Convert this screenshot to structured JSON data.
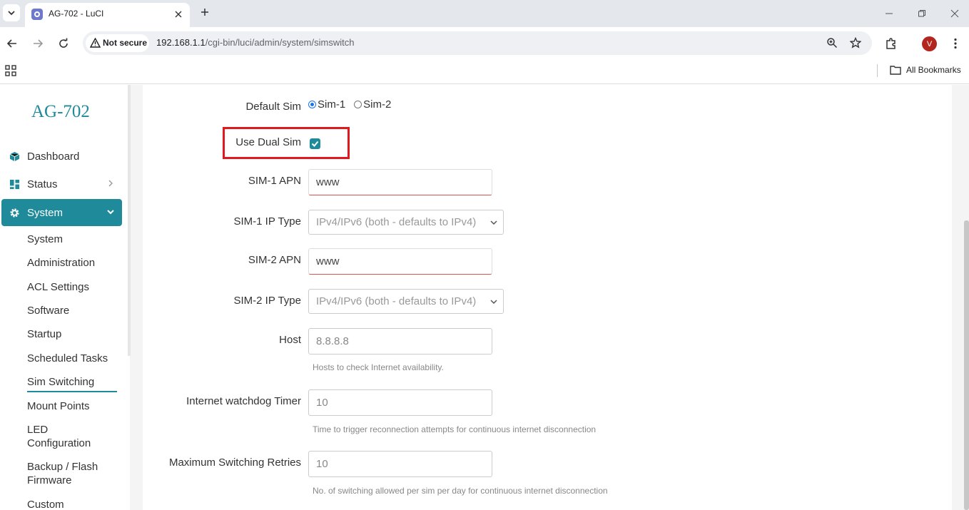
{
  "browser": {
    "tab_title": "AG-702 - LuCI",
    "security_label": "Not secure",
    "url_host": "192.168.1.1",
    "url_path": "/cgi-bin/luci/admin/system/simswitch",
    "avatar_letter": "V",
    "all_bookmarks": "All Bookmarks"
  },
  "sidebar": {
    "brand": "AG-702",
    "nav": [
      {
        "label": "Dashboard",
        "icon": "cube-icon"
      },
      {
        "label": "Status",
        "icon": "grid-icon"
      },
      {
        "label": "System",
        "icon": "gear-icon"
      }
    ],
    "sub": [
      "System",
      "Administration",
      "ACL Settings",
      "Software",
      "Startup",
      "Scheduled Tasks",
      "Sim Switching",
      "Mount Points",
      "LED Configuration",
      "Backup / Flash Firmware",
      "Custom"
    ],
    "accent": "#1f8a99"
  },
  "form": {
    "default_sim": {
      "label": "Default Sim",
      "options": [
        "Sim-1",
        "Sim-2"
      ],
      "selected": "Sim-1"
    },
    "dual_sim": {
      "label": "Use Dual Sim",
      "checked": true
    },
    "sim1_apn": {
      "label": "SIM-1 APN",
      "value": "www"
    },
    "sim1_ip": {
      "label": "SIM-1 IP Type",
      "value": "IPv4/IPv6 (both - defaults to IPv4)"
    },
    "sim2_apn": {
      "label": "SIM-2 APN",
      "value": "www"
    },
    "sim2_ip": {
      "label": "SIM-2 IP Type",
      "value": "IPv4/IPv6 (both - defaults to IPv4)"
    },
    "host": {
      "label": "Host",
      "value": "8.8.8.8",
      "hint": "Hosts to check Internet availability."
    },
    "watchdog": {
      "label": "Internet watchdog Timer",
      "value": "10",
      "hint": "Time to trigger reconnection attempts for continuous internet disconnection"
    },
    "retries": {
      "label": "Maximum Switching Retries",
      "value": "10",
      "hint": "No. of switching allowed per sim per day for continuous internet disconnection"
    }
  },
  "colors": {
    "highlight": "#e0191f",
    "accent": "#1f8a99"
  }
}
